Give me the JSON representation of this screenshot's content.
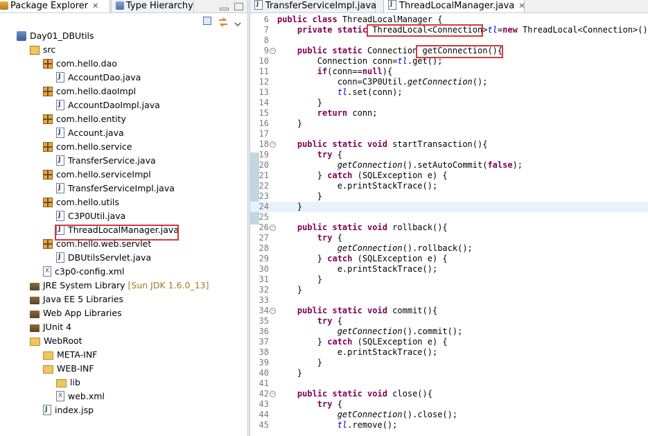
{
  "left_panel": {
    "tabs": [
      {
        "label": "Package Explorer",
        "close": "✕"
      },
      {
        "label": "Type Hierarchy"
      }
    ],
    "tree": [
      {
        "label": "Day01_DBUtils",
        "icon": "project-icon",
        "indent": 0
      },
      {
        "label": "src",
        "icon": "source-folder-icon",
        "indent": 1
      },
      {
        "label": "com.hello.dao",
        "icon": "package-icon",
        "indent": 2
      },
      {
        "label": "AccountDao.java",
        "icon": "java-file-icon",
        "indent": 3
      },
      {
        "label": "com.hello.daoImpl",
        "icon": "package-icon",
        "indent": 2
      },
      {
        "label": "AccountDaoImpl.java",
        "icon": "java-file-icon",
        "indent": 3
      },
      {
        "label": "com.hello.entity",
        "icon": "package-icon",
        "indent": 2
      },
      {
        "label": "Account.java",
        "icon": "java-file-icon",
        "indent": 3
      },
      {
        "label": "com.hello.service",
        "icon": "package-icon",
        "indent": 2
      },
      {
        "label": "TransferService.java",
        "icon": "java-file-icon",
        "indent": 3
      },
      {
        "label": "com.hello.serviceImpl",
        "icon": "package-icon",
        "indent": 2
      },
      {
        "label": "TransferServiceImpl.java",
        "icon": "java-file-icon",
        "indent": 3
      },
      {
        "label": "com.hello.utils",
        "icon": "package-icon",
        "indent": 2
      },
      {
        "label": "C3P0Util.java",
        "icon": "java-file-icon",
        "indent": 3
      },
      {
        "label": "ThreadLocalManager.java",
        "icon": "java-file-icon",
        "indent": 3
      },
      {
        "label": "com.hello.web.servlet",
        "icon": "package-icon",
        "indent": 2
      },
      {
        "label": "DBUtilsServlet.java",
        "icon": "java-file-icon",
        "indent": 3
      },
      {
        "label": "c3p0-config.xml",
        "icon": "xml-file-icon",
        "indent": 2
      },
      {
        "label": "JRE System Library",
        "decoration": "[Sun JDK 1.6.0_13]",
        "icon": "library-icon",
        "indent": 1
      },
      {
        "label": "Java EE 5 Libraries",
        "icon": "library-icon",
        "indent": 1
      },
      {
        "label": "Web App Libraries",
        "icon": "library-icon",
        "indent": 1
      },
      {
        "label": "JUnit 4",
        "icon": "library-icon",
        "indent": 1
      },
      {
        "label": "WebRoot",
        "icon": "folder-icon",
        "indent": 1
      },
      {
        "label": "META-INF",
        "icon": "folder-icon",
        "indent": 2
      },
      {
        "label": "WEB-INF",
        "icon": "folder-icon",
        "indent": 2
      },
      {
        "label": "lib",
        "icon": "folder-icon",
        "indent": 3
      },
      {
        "label": "web.xml",
        "icon": "xml-file-icon",
        "indent": 3
      },
      {
        "label": "index.jsp",
        "icon": "jsp-file-icon",
        "indent": 2
      }
    ],
    "selected_item": "ThreadLocalManager.java"
  },
  "editor": {
    "tabs": [
      {
        "label": "TransferServiceImpl.java",
        "active": false
      },
      {
        "label": "ThreadLocalManager.java",
        "active": true,
        "close": "✕"
      }
    ],
    "lines": [
      {
        "n": "6",
        "fold": false,
        "tokens": [
          [
            "kw",
            "public class"
          ],
          [
            "",
            "ThreadLocalManager {"
          ]
        ]
      },
      {
        "n": "7",
        "fold": false,
        "tokens": [
          [
            "",
            "    "
          ],
          [
            "kw",
            "private static"
          ],
          [
            "",
            "ThreadLocal<Connection>"
          ],
          [
            "",
            ""
          ],
          [
            "fld",
            "tl"
          ],
          [
            "",
            "="
          ],
          [
            "kw",
            "new"
          ],
          [
            "",
            " ThreadLocal<Connection>();"
          ]
        ]
      },
      {
        "n": "8",
        "fold": false,
        "tokens": []
      },
      {
        "n": "9",
        "fold": true,
        "tokens": [
          [
            "",
            "    "
          ],
          [
            "kw",
            "public static"
          ],
          [
            "",
            " Connection "
          ],
          [
            "",
            "getConnection(){"
          ]
        ]
      },
      {
        "n": "10",
        "fold": false,
        "tokens": [
          [
            "",
            "        Connection conn="
          ],
          [
            "fld",
            "tl"
          ],
          [
            "",
            ".get();"
          ]
        ]
      },
      {
        "n": "11",
        "fold": false,
        "tokens": [
          [
            "",
            "        "
          ],
          [
            "kw",
            "if"
          ],
          [
            "",
            "(conn=="
          ],
          [
            "kw",
            "null"
          ],
          [
            "",
            "){"
          ]
        ]
      },
      {
        "n": "12",
        "fold": false,
        "tokens": [
          [
            "",
            "            conn=C3P0Util."
          ],
          [
            "st",
            "getConnection"
          ],
          [
            "",
            "();"
          ]
        ]
      },
      {
        "n": "13",
        "fold": false,
        "tokens": [
          [
            "",
            "            "
          ],
          [
            "fld",
            "tl"
          ],
          [
            "",
            ".set(conn);"
          ]
        ]
      },
      {
        "n": "14",
        "fold": false,
        "tokens": [
          [
            "",
            "        }"
          ]
        ]
      },
      {
        "n": "15",
        "fold": false,
        "tokens": [
          [
            "",
            "        "
          ],
          [
            "kw",
            "return"
          ],
          [
            "",
            " conn;"
          ]
        ]
      },
      {
        "n": "16",
        "fold": false,
        "tokens": [
          [
            "",
            "    }"
          ]
        ]
      },
      {
        "n": "17",
        "fold": false,
        "tokens": []
      },
      {
        "n": "18",
        "fold": true,
        "tokens": [
          [
            "",
            "    "
          ],
          [
            "kw",
            "public static void"
          ],
          [
            "",
            " startTransaction(){"
          ]
        ]
      },
      {
        "n": "19",
        "fold": false,
        "tokens": [
          [
            "",
            "        "
          ],
          [
            "kw",
            "try"
          ],
          [
            "",
            " {"
          ]
        ]
      },
      {
        "n": "20",
        "fold": false,
        "tokens": [
          [
            "",
            "            "
          ],
          [
            "st",
            "getConnection"
          ],
          [
            "",
            "().setAutoCommit("
          ],
          [
            "kw",
            "false"
          ],
          [
            "",
            ");"
          ]
        ]
      },
      {
        "n": "21",
        "fold": false,
        "tokens": [
          [
            "",
            "        } "
          ],
          [
            "kw",
            "catch"
          ],
          [
            "",
            " (SQLException e) {"
          ]
        ]
      },
      {
        "n": "22",
        "fold": false,
        "tokens": [
          [
            "",
            "            e.printStackTrace();"
          ]
        ]
      },
      {
        "n": "23",
        "fold": false,
        "tokens": [
          [
            "",
            "        }"
          ]
        ]
      },
      {
        "n": "24",
        "fold": false,
        "tokens": [
          [
            "",
            "    }"
          ]
        ],
        "current": true
      },
      {
        "n": "25",
        "fold": false,
        "tokens": []
      },
      {
        "n": "26",
        "fold": true,
        "tokens": [
          [
            "",
            "    "
          ],
          [
            "kw",
            "public static void"
          ],
          [
            "",
            " rollback(){"
          ]
        ]
      },
      {
        "n": "27",
        "fold": false,
        "tokens": [
          [
            "",
            "        "
          ],
          [
            "kw",
            "try"
          ],
          [
            "",
            " {"
          ]
        ]
      },
      {
        "n": "28",
        "fold": false,
        "tokens": [
          [
            "",
            "            "
          ],
          [
            "st",
            "getConnection"
          ],
          [
            "",
            "().rollback();"
          ]
        ]
      },
      {
        "n": "29",
        "fold": false,
        "tokens": [
          [
            "",
            "        } "
          ],
          [
            "kw",
            "catch"
          ],
          [
            "",
            " (SQLException e) {"
          ]
        ]
      },
      {
        "n": "30",
        "fold": false,
        "tokens": [
          [
            "",
            "            e.printStackTrace();"
          ]
        ]
      },
      {
        "n": "31",
        "fold": false,
        "tokens": [
          [
            "",
            "        }"
          ]
        ]
      },
      {
        "n": "32",
        "fold": false,
        "tokens": [
          [
            "",
            "    }"
          ]
        ]
      },
      {
        "n": "33",
        "fold": false,
        "tokens": []
      },
      {
        "n": "34",
        "fold": true,
        "tokens": [
          [
            "",
            "    "
          ],
          [
            "kw",
            "public static void"
          ],
          [
            "",
            " commit(){"
          ]
        ]
      },
      {
        "n": "35",
        "fold": false,
        "tokens": [
          [
            "",
            "        "
          ],
          [
            "kw",
            "try"
          ],
          [
            "",
            " {"
          ]
        ]
      },
      {
        "n": "36",
        "fold": false,
        "tokens": [
          [
            "",
            "            "
          ],
          [
            "st",
            "getConnection"
          ],
          [
            "",
            "().commit();"
          ]
        ]
      },
      {
        "n": "37",
        "fold": false,
        "tokens": [
          [
            "",
            "        } "
          ],
          [
            "kw",
            "catch"
          ],
          [
            "",
            " (SQLException e) {"
          ]
        ]
      },
      {
        "n": "38",
        "fold": false,
        "tokens": [
          [
            "",
            "            e.printStackTrace();"
          ]
        ]
      },
      {
        "n": "39",
        "fold": false,
        "tokens": [
          [
            "",
            "        }"
          ]
        ]
      },
      {
        "n": "40",
        "fold": false,
        "tokens": [
          [
            "",
            "    }"
          ]
        ]
      },
      {
        "n": "41",
        "fold": false,
        "tokens": []
      },
      {
        "n": "42",
        "fold": true,
        "tokens": [
          [
            "",
            "    "
          ],
          [
            "kw",
            "public static void"
          ],
          [
            "",
            " close(){"
          ]
        ]
      },
      {
        "n": "43",
        "fold": false,
        "tokens": [
          [
            "",
            "        "
          ],
          [
            "kw",
            "try"
          ],
          [
            "",
            " {"
          ]
        ]
      },
      {
        "n": "44",
        "fold": false,
        "tokens": [
          [
            "",
            "            "
          ],
          [
            "st",
            "getConnection"
          ],
          [
            "",
            "().close();"
          ]
        ]
      },
      {
        "n": "45",
        "fold": false,
        "tokens": [
          [
            "",
            "            "
          ],
          [
            "fld",
            "tl"
          ],
          [
            "",
            ".remove();"
          ]
        ]
      }
    ]
  },
  "colors": {
    "highlight_box": "#d4383b",
    "keyword": "#7f0055",
    "field": "#0000c0"
  }
}
